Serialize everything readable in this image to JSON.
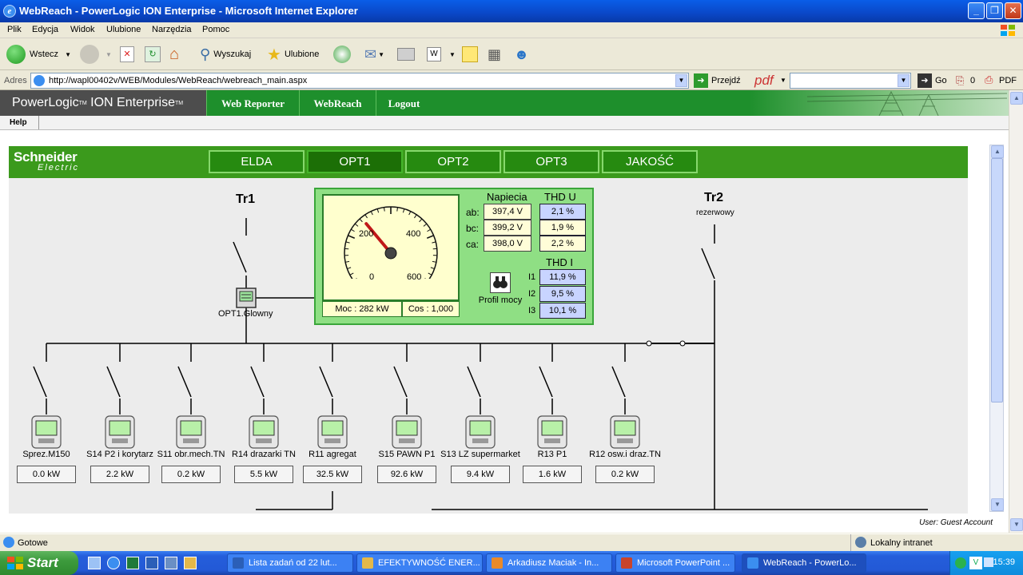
{
  "window": {
    "title": "WebReach - PowerLogic ION Enterprise - Microsoft Internet Explorer"
  },
  "menu": [
    "Plik",
    "Edycja",
    "Widok",
    "Ulubione",
    "Narzędzia",
    "Pomoc"
  ],
  "toolbar": {
    "back": "Wstecz",
    "search": "Wyszukaj",
    "favorites": "Ulubione"
  },
  "address": {
    "label": "Adres",
    "url": "http://wapl00402v/WEB/Modules/WebReach/webreach_main.aspx",
    "go": "Przejdź",
    "pdf": "pdf",
    "go2": "Go",
    "count": "0",
    "pdf2": "PDF"
  },
  "ion": {
    "brand_a": "PowerLogic",
    "tm1": "TM",
    "brand_b": " ION Enterprise",
    "tm2": "TM",
    "nav": [
      "Web Reporter",
      "WebReach",
      "Logout"
    ],
    "help": "Help"
  },
  "scada": {
    "logo_a": "Schneider",
    "logo_b": "Electric",
    "tabs": [
      "ELDA",
      "OPT1",
      "OPT2",
      "OPT3",
      "JAKOŚĆ"
    ],
    "active_tab": 1,
    "tr1": "Tr1",
    "tr2": "Tr2",
    "tr2_sub": "rezerwowy",
    "main_meter": "OPT1.Glowny",
    "gauge": {
      "ticks": [
        "0",
        "200",
        "400",
        "600"
      ],
      "value": 282,
      "max": 800,
      "moc": "Moc : 282 kW",
      "cos": "Cos : 1,000"
    },
    "napiecia": {
      "title": "Napiecia",
      "rows": [
        {
          "l": "ab:",
          "v": "397,4 V"
        },
        {
          "l": "bc:",
          "v": "399,2 V"
        },
        {
          "l": "ca:",
          "v": "398,0 V"
        }
      ]
    },
    "thdu": {
      "title": "THD U",
      "values": [
        "2,1 %",
        "1,9 %",
        "2,2 %"
      ]
    },
    "thdi": {
      "title": "THD I",
      "rows": [
        {
          "l": "I1",
          "v": "11,9 %"
        },
        {
          "l": "I2",
          "v": "9,5 %"
        },
        {
          "l": "I3",
          "v": "10,1 %"
        }
      ]
    },
    "profil": "Profil mocy",
    "devices": [
      {
        "name": "Sprez.M150",
        "kw": "0.0 kW"
      },
      {
        "name": "S14 P2 i korytarz",
        "kw": "2.2 kW"
      },
      {
        "name": "S11 obr.mech.TN",
        "kw": "0.2 kW"
      },
      {
        "name": "R14 drazarki TN",
        "kw": "5.5 kW"
      },
      {
        "name": "R11 agregat",
        "kw": "32.5 kW"
      },
      {
        "name": "S15 PAWN P1",
        "kw": "92.6 kW"
      },
      {
        "name": "S13 LZ supermarket",
        "kw": "9.4 kW"
      },
      {
        "name": "R13 P1",
        "kw": "1.6 kW"
      },
      {
        "name": "R12 osw.i draz.TN",
        "kw": "0.2 kW"
      }
    ]
  },
  "user": "User: Guest Account",
  "status": {
    "left": "Gotowe",
    "right": "Lokalny intranet"
  },
  "taskbar": {
    "start": "Start",
    "tasks": [
      "Lista zadań od 22 lut...",
      "EFEKTYWNOŚĆ ENER...",
      "Arkadiusz Maciak - In...",
      "Microsoft PowerPoint ...",
      "WebReach - PowerLo..."
    ],
    "clock": "15:39"
  }
}
